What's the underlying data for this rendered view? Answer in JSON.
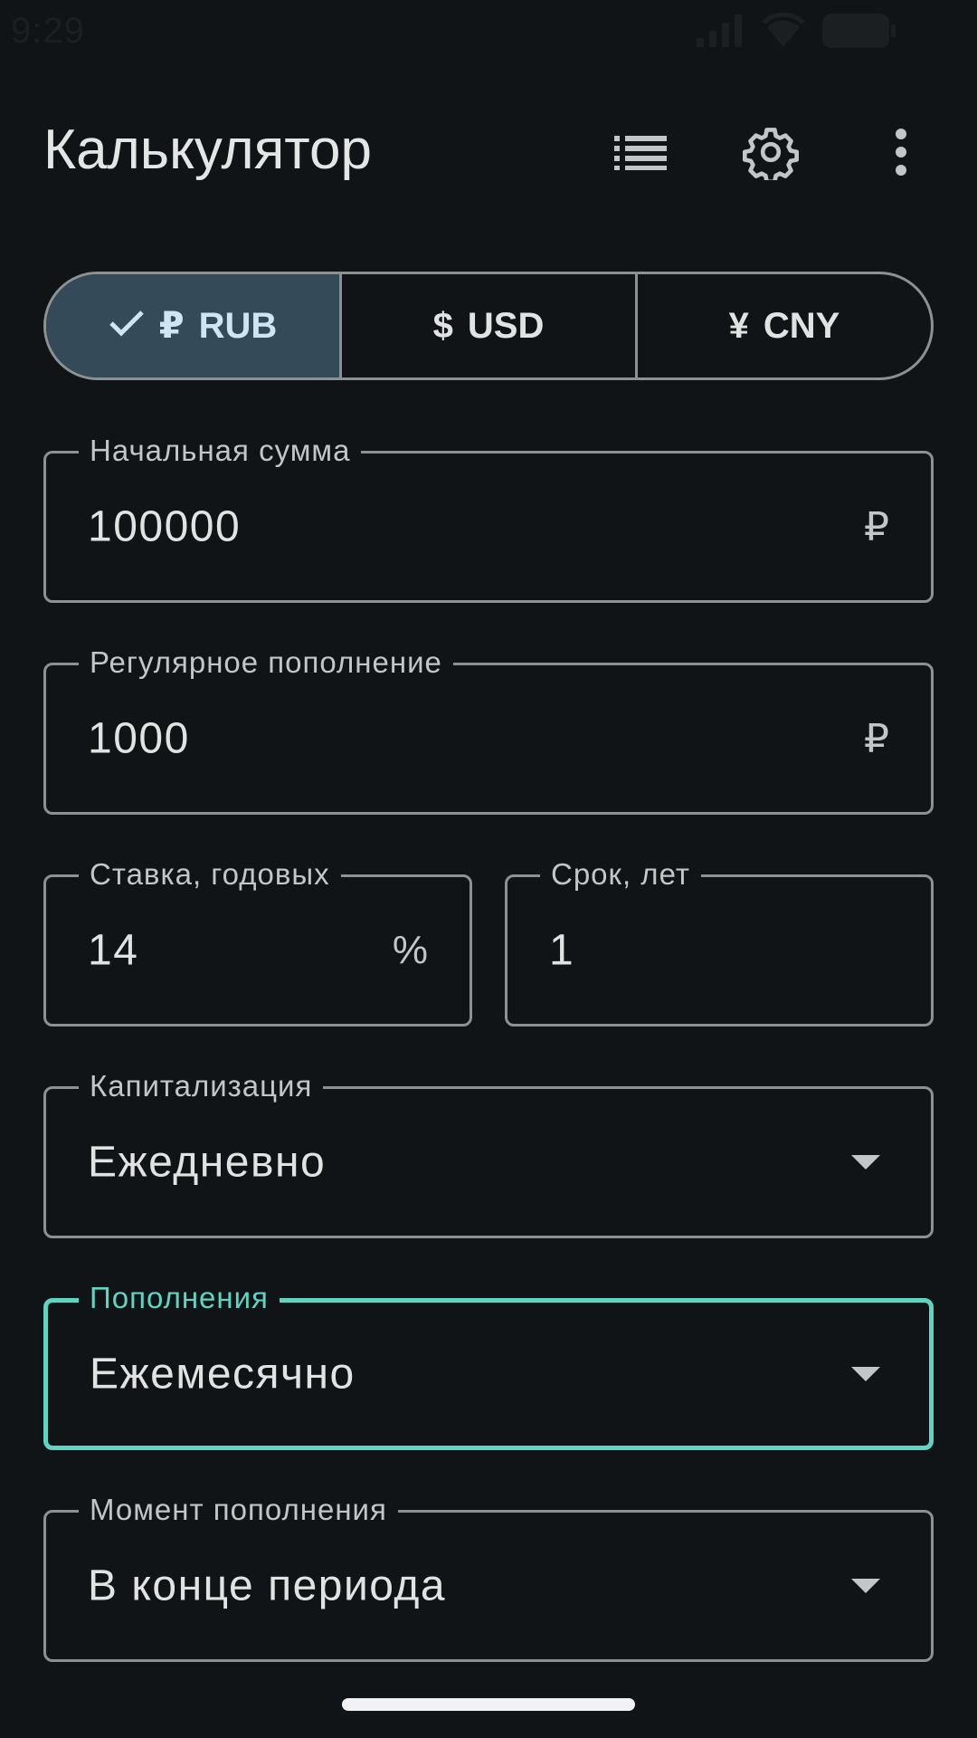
{
  "status_bar": {
    "time": "9:29",
    "icons": [
      "signal-icon",
      "wifi-icon",
      "battery-icon"
    ]
  },
  "app_bar": {
    "title": "Калькулятор",
    "actions": [
      "list-icon",
      "gear-icon",
      "more-vert-icon"
    ]
  },
  "currency": {
    "options": [
      {
        "symbol": "₽",
        "code": "RUB",
        "selected": true
      },
      {
        "symbol": "$",
        "code": "USD",
        "selected": false
      },
      {
        "symbol": "¥",
        "code": "CNY",
        "selected": false
      }
    ]
  },
  "form": {
    "initial_amount": {
      "label": "Начальная сумма",
      "value": "100000",
      "suffix": "₽"
    },
    "regular_topup": {
      "label": "Регулярное пополнение",
      "value": "1000",
      "suffix": "₽"
    },
    "rate": {
      "label": "Ставка, годовых",
      "value": "14",
      "suffix": "%"
    },
    "term": {
      "label": "Срок, лет",
      "value": "1"
    },
    "capitalization": {
      "label": "Капитализация",
      "value": "Ежедневно"
    },
    "topups": {
      "label": "Пополнения",
      "value": "Ежемесячно"
    },
    "topup_moment": {
      "label": "Момент пополнения",
      "value": "В конце периода"
    }
  },
  "colors": {
    "background": "#111416",
    "selected_segment": "#344a59",
    "focus_accent": "#5fd4c2",
    "outline": "#8d9192"
  }
}
